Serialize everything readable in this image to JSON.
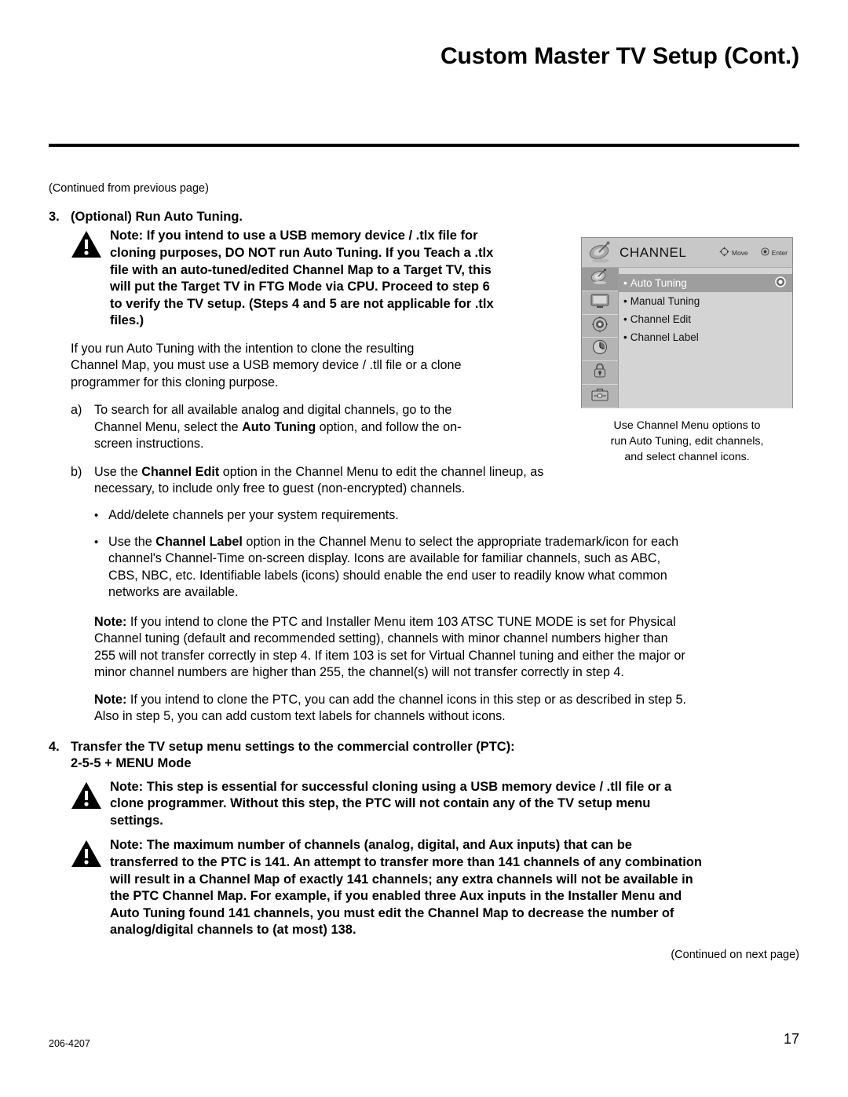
{
  "header": {
    "title": "Custom Master TV Setup (Cont.)"
  },
  "continued_from": "(Continued from previous page)",
  "steps": [
    {
      "number": "3.",
      "title": "(Optional) Run Auto Tuning.",
      "warning": "Note: If you intend to use a USB memory device / .tlx file for cloning purposes, DO NOT run Auto Tuning. If you Teach a .tlx file with an auto-tuned/edited Channel Map to a Target TV, this will put the Target TV in FTG Mode via CPU. Proceed to step 6 to verify the TV setup. (Steps 4 and 5 are not applicable for .tlx files.)",
      "paragraph": "If you run Auto Tuning with the intention to clone the resulting Channel Map, you must use a USB memory device / .tll file or a clone programmer for this cloning purpose.",
      "sub_a": {
        "marker": "a)",
        "part1": "To search for all available analog and digital channels, go to the Channel Menu, select the ",
        "bold": "Auto Tuning",
        "part2": " option, and follow the on-screen instructions."
      },
      "sub_b": {
        "marker": "b)",
        "part1": "Use the ",
        "bold": "Channel Edit",
        "part2": " option in the Channel Menu to edit the channel lineup, as necessary, to include only free to guest (non-encrypted) channels."
      },
      "bullets": [
        {
          "part1": "Add/delete channels per your system requirements.",
          "bold": "",
          "part2": ""
        },
        {
          "part1": "Use the ",
          "bold": "Channel Label",
          "part2": " option in the Channel Menu to select the appropriate trademark/icon for each channel's Channel-Time on-screen display. Icons are available for familiar channels, such as ABC, CBS, NBC, etc. Identifiable labels (icons) should enable the end user to readily know what common networks are available."
        }
      ],
      "note1_label": "Note:",
      "note1_text": " If you intend to clone the PTC and Installer Menu item 103 ATSC TUNE MODE is set for Physical Channel tuning (default and recommended setting), channels with minor channel numbers higher than 255 will not transfer correctly in step 4. If item 103 is set for Virtual Channel tuning and either the major or minor channel numbers are higher than 255, the channel(s) will not transfer correctly in step 4.",
      "note2_label": "Note:",
      "note2_text": " If you intend to clone the PTC, you can add the channel icons in this step or as described in step 5. Also in step 5, you can add custom text labels for channels without icons."
    },
    {
      "number": "4.",
      "title_line1": "Transfer the TV setup menu settings to the commercial controller (PTC):",
      "title_line2": "2-5-5 + MENU Mode",
      "warning1": "Note: This step is essential for successful cloning using a USB memory device / .tll file or a clone programmer. Without this step, the PTC will not contain any of the TV setup menu settings.",
      "warning2": "Note: The maximum number of channels (analog, digital, and Aux inputs) that can be transferred to the PTC is 141. An attempt to transfer more than 141 channels of any combination will result in a Channel Map of exactly 141 channels; any extra channels will not be available in the PTC Channel Map. For example, if you enabled three Aux inputs in the Installer Menu and Auto Tuning found 141 channels, you must edit the Channel Map to decrease the number of analog/digital channels to (at most) 138."
    }
  ],
  "figure": {
    "osd": {
      "title": "CHANNEL",
      "hint_move": "Move",
      "hint_enter": "Enter",
      "menu_items": [
        {
          "label": "Auto Tuning",
          "selected": true,
          "has_radio": true
        },
        {
          "label": "Manual Tuning",
          "selected": false,
          "has_radio": false
        },
        {
          "label": "Channel Edit",
          "selected": false,
          "has_radio": false
        },
        {
          "label": "Channel Label",
          "selected": false,
          "has_radio": false
        }
      ],
      "rail_icons": [
        "satellite-dish-icon",
        "picture-tv-icon",
        "audio-speaker-icon",
        "time-clock-icon",
        "lock-padlock-icon",
        "setup-toolbox-icon"
      ],
      "bullet_char": "•"
    },
    "caption_line1": "Use Channel Menu options to",
    "caption_line2": "run Auto Tuning, edit channels,",
    "caption_line3": "and select channel icons."
  },
  "footer": {
    "continued_next": "(Continued on next page)",
    "doc_number": "206-4207",
    "page_number": "17"
  },
  "colors": {
    "osd_background": "#cfcfcf",
    "osd_selected": "#9e9e9e",
    "osd_rail": "#b4b4b4",
    "text": "#000000"
  }
}
